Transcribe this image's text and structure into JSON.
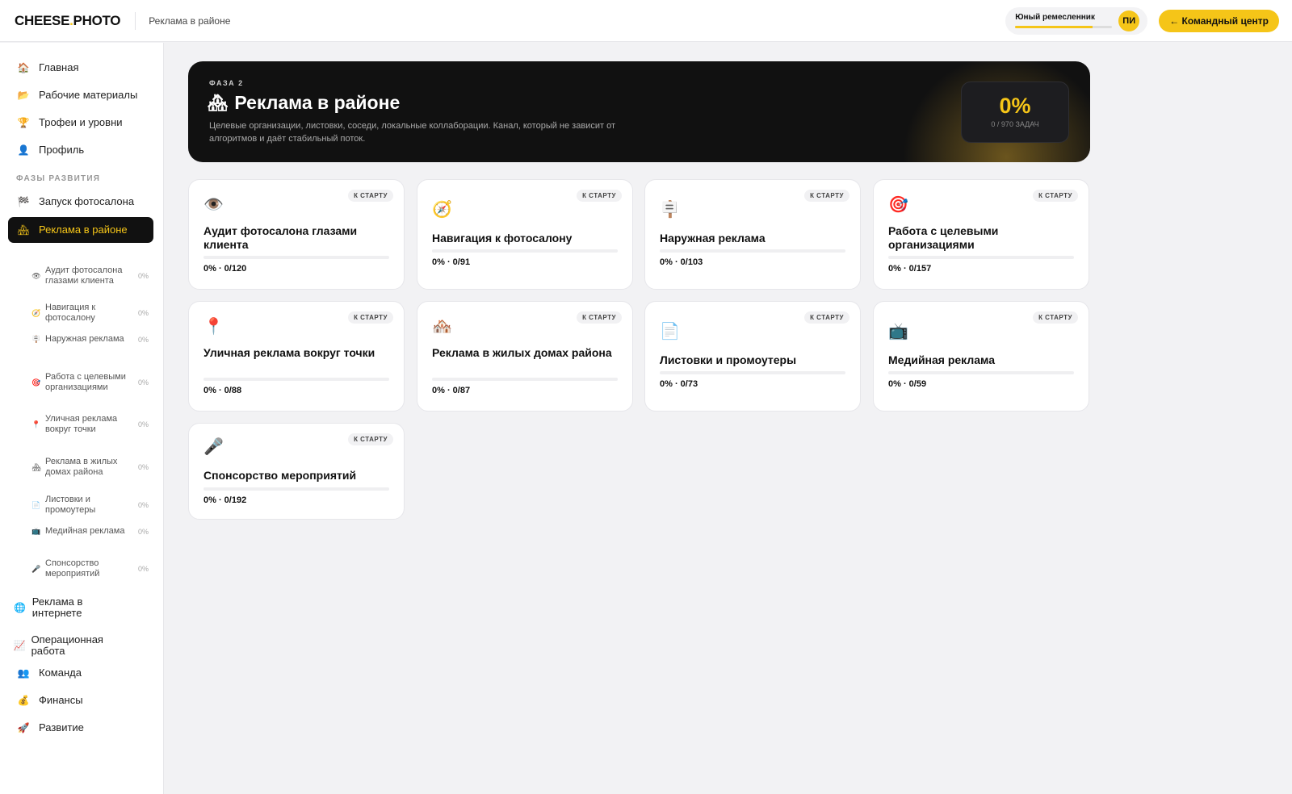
{
  "header": {
    "logo_main": "CHEESE",
    "logo_dot": ".",
    "logo_tail": "PHOTO",
    "breadcrumb": "Реклама в районе",
    "rank_name": "Юный ремесленник",
    "rank_progress": 0.8,
    "avatar_initials": "ПИ",
    "command_button": "← Командный центр"
  },
  "sidebar": {
    "main_items": [
      {
        "icon": "🏠",
        "icon_name": "home-icon",
        "label": "Главная"
      },
      {
        "icon": "📂",
        "icon_name": "folder-icon",
        "label": "Рабочие материалы"
      },
      {
        "icon": "🏆",
        "icon_name": "trophy-icon",
        "label": "Трофеи и уровни"
      },
      {
        "icon": "👤",
        "icon_name": "user-icon",
        "label": "Профиль"
      }
    ],
    "section_label": "ФАЗЫ РАЗВИТИЯ",
    "phase_items": [
      {
        "icon": "🏁",
        "icon_name": "flag-icon",
        "label": "Запуск фотосалона"
      },
      {
        "icon": "🏘",
        "icon_name": "houses-icon",
        "label": "Реклама в районе"
      }
    ],
    "sub_items": [
      {
        "icon": "👁",
        "icon_name": "eye-icon",
        "label": "Аудит фотосалона глазами клиента",
        "pct": "0%"
      },
      {
        "icon": "🧭",
        "icon_name": "compass-icon",
        "label": "Навигация к фотосалону",
        "pct": "0%"
      },
      {
        "icon": "🪧",
        "icon_name": "signboard-icon",
        "label": "Наружная реклама",
        "pct": "0%"
      },
      {
        "icon": "🎯",
        "icon_name": "target-icon",
        "label": "Работа с целевыми организациями",
        "pct": "0%"
      },
      {
        "icon": "📍",
        "icon_name": "pin-icon",
        "label": "Уличная реклама вокруг точки",
        "pct": "0%"
      },
      {
        "icon": "🏘",
        "icon_name": "houses-icon",
        "label": "Реклама в жилых домах района",
        "pct": "0%"
      },
      {
        "icon": "📄",
        "icon_name": "leaflet-icon",
        "label": "Листовки и промоутеры",
        "pct": "0%"
      },
      {
        "icon": "📺",
        "icon_name": "tv-icon",
        "label": "Медийная реклама",
        "pct": "0%"
      },
      {
        "icon": "🎤",
        "icon_name": "microphone-icon",
        "label": "Спонсорство мероприятий",
        "pct": "0%"
      }
    ],
    "bottom_items": [
      {
        "icon": "🌐",
        "icon_name": "globe-icon",
        "label": "Реклама в интернете"
      },
      {
        "icon": "📈",
        "icon_name": "chart-icon",
        "label": "Операционная работа"
      },
      {
        "icon": "👥",
        "icon_name": "team-icon",
        "label": "Команда"
      },
      {
        "icon": "💰",
        "icon_name": "money-bag-icon",
        "label": "Финансы"
      },
      {
        "icon": "🚀",
        "icon_name": "rocket-icon",
        "label": "Развитие"
      }
    ]
  },
  "hero": {
    "phase": "ФАЗА 2",
    "icon": "🏘",
    "title": "Реклама в районе",
    "description": "Целевые организации, листовки, соседи, локальные коллаборации. Канал, который не зависит от алгоритмов и даёт стабильный поток.",
    "percent": "0%",
    "tasks": "0 / 970 ЗАДАЧ"
  },
  "cards": [
    {
      "icon": "👁️",
      "icon_name": "eye-icon",
      "title": "Аудит фотосалона глазами клиента",
      "badge": "К СТАРТУ",
      "stat": "0% · 0/120",
      "progress": 0
    },
    {
      "icon": "🧭",
      "icon_name": "compass-icon",
      "title": "Навигация к фотосалону",
      "badge": "К СТАРТУ",
      "stat": "0% · 0/91",
      "progress": 0
    },
    {
      "icon": "🪧",
      "icon_name": "signboard-icon",
      "title": "Наружная реклама",
      "badge": "К СТАРТУ",
      "stat": "0% · 0/103",
      "progress": 0
    },
    {
      "icon": "🎯",
      "icon_name": "target-icon",
      "title": "Работа с целевыми организациями",
      "badge": "К СТАРТУ",
      "stat": "0% · 0/157",
      "progress": 0
    },
    {
      "icon": "📍",
      "icon_name": "pin-icon",
      "title": "Уличная реклама вокруг точки",
      "badge": "К СТАРТУ",
      "stat": "0% · 0/88",
      "progress": 0
    },
    {
      "icon": "🏘️",
      "icon_name": "houses-icon",
      "title": "Реклама в жилых домах района",
      "badge": "К СТАРТУ",
      "stat": "0% · 0/87",
      "progress": 0
    },
    {
      "icon": "📄",
      "icon_name": "leaflet-icon",
      "title": "Листовки и промоутеры",
      "badge": "К СТАРТУ",
      "stat": "0% · 0/73",
      "progress": 0
    },
    {
      "icon": "📺",
      "icon_name": "tv-icon",
      "title": "Медийная реклама",
      "badge": "К СТАРТУ",
      "stat": "0% · 0/59",
      "progress": 0
    },
    {
      "icon": "🎤",
      "icon_name": "microphone-icon",
      "title": "Спонсорство мероприятий",
      "badge": "К СТАРТУ",
      "stat": "0% · 0/192",
      "progress": 0
    }
  ],
  "colors": {
    "accent": "#f5c518",
    "dark": "#111111",
    "background": "#f2f2f4"
  }
}
